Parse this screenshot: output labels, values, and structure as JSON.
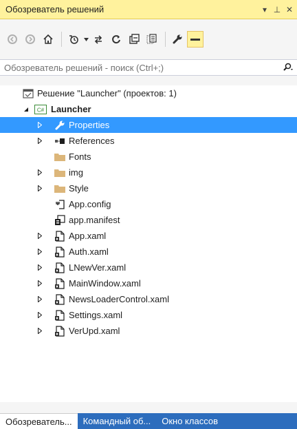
{
  "panel": {
    "title": "Обозреватель решений",
    "pin_glyph": "▾",
    "pin2_glyph": "⊥",
    "close_glyph": "✕"
  },
  "search": {
    "placeholder": "Обозреватель решений - поиск (Ctrl+;)"
  },
  "tree": {
    "solution": "Решение \"Launcher\"  (проектов: 1)",
    "project": "Launcher",
    "items": [
      {
        "label": "Properties",
        "icon": "wrench-icon"
      },
      {
        "label": "References",
        "icon": "references-icon"
      },
      {
        "label": "Fonts",
        "icon": "folder-icon"
      },
      {
        "label": "img",
        "icon": "folder-icon"
      },
      {
        "label": "Style",
        "icon": "folder-icon"
      },
      {
        "label": "App.config",
        "icon": "config-icon"
      },
      {
        "label": "app.manifest",
        "icon": "manifest-icon"
      },
      {
        "label": "App.xaml",
        "icon": "xaml-file-icon"
      },
      {
        "label": "Auth.xaml",
        "icon": "xaml-file-icon"
      },
      {
        "label": "LNewVer.xaml",
        "icon": "xaml-file-icon"
      },
      {
        "label": "MainWindow.xaml",
        "icon": "xaml-file-icon"
      },
      {
        "label": "NewsLoaderControl.xaml",
        "icon": "xaml-file-icon"
      },
      {
        "label": "Settings.xaml",
        "icon": "xaml-file-icon"
      },
      {
        "label": "VerUpd.xaml",
        "icon": "xaml-file-icon"
      }
    ]
  },
  "tabs": [
    {
      "label": "Обозреватель..."
    },
    {
      "label": "Командный об..."
    },
    {
      "label": "Окно классов"
    }
  ],
  "colors": {
    "title_bg": "#fff29d",
    "selection": "#3399ff",
    "tab_strip": "#2d6dbd",
    "folder": "#dcb67a"
  }
}
